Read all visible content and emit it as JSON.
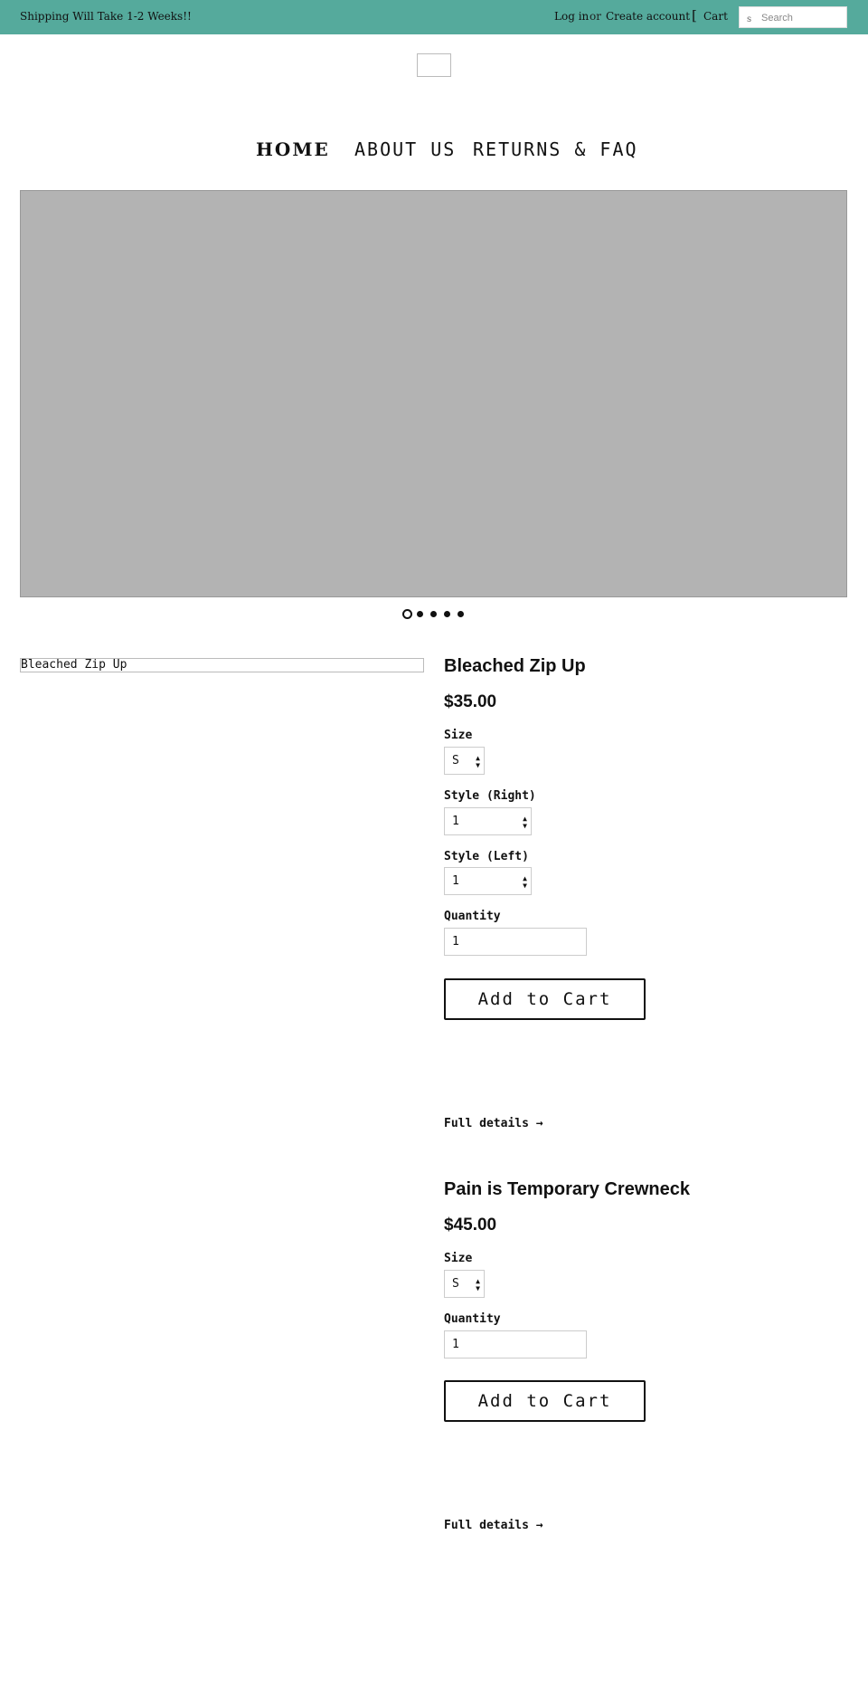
{
  "topbar": {
    "announcement": "Shipping Will Take 1-2 Weeks!!",
    "login": "Log in",
    "or": "or",
    "create_account": "Create account",
    "cart_icon": "[",
    "cart": "Cart",
    "search_icon": "s",
    "search_placeholder": "Search",
    "bar_color": "#55aa9c"
  },
  "nav": {
    "home": "HOME",
    "about": "ABOUT US",
    "returns": "RETURNS & FAQ"
  },
  "slideshow": {
    "slide_count": 5,
    "active_index": 0
  },
  "products": [
    {
      "image_alt": "Bleached Zip Up",
      "title": "Bleached Zip Up",
      "price": "$35.00",
      "options": [
        {
          "label": "Size",
          "value": "S"
        },
        {
          "label": "Style (Right)",
          "value": "1"
        },
        {
          "label": "Style (Left)",
          "value": "1"
        }
      ],
      "quantity_label": "Quantity",
      "quantity": "1",
      "add_to_cart": "Add to Cart",
      "full_details": "Full details →"
    },
    {
      "title": "Pain is Temporary Crewneck",
      "price": "$45.00",
      "options": [
        {
          "label": "Size",
          "value": "S"
        }
      ],
      "quantity_label": "Quantity",
      "quantity": "1",
      "add_to_cart": "Add to Cart",
      "full_details": "Full details →"
    }
  ]
}
